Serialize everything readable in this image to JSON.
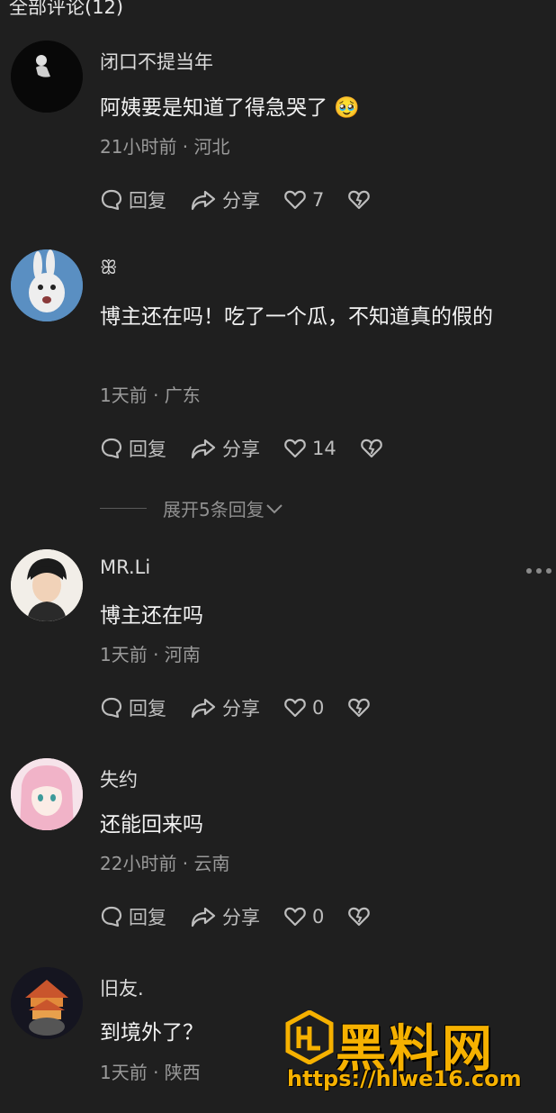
{
  "header": {
    "title": "全部评论(12)"
  },
  "actions": {
    "reply": "回复",
    "share": "分享"
  },
  "expand": {
    "label": "展开5条回复"
  },
  "comments": [
    {
      "name": "闭口不提当年",
      "text": "阿姨要是知道了得急哭了 🥹",
      "meta": "21小时前 · 河北",
      "likes": "7"
    },
    {
      "name": "ꕥ",
      "text": "博主还在吗！吃了一个瓜，不知道真的假的",
      "meta": "1天前 · 广东",
      "likes": "14"
    },
    {
      "name": "MR.Li",
      "text": "博主还在吗",
      "meta": "1天前 · 河南",
      "likes": "0"
    },
    {
      "name": "失约",
      "text": "还能回来吗",
      "meta": "22小时前 · 云南",
      "likes": "0"
    },
    {
      "name": "旧友.",
      "text": "到境外了？",
      "meta": "1天前 · 陕西",
      "likes": ""
    }
  ],
  "watermark": {
    "title": "黑料网",
    "url": "https://hlwe16.com"
  },
  "colors": {
    "background": "#1f1f1f",
    "accent": "#f6b100"
  }
}
